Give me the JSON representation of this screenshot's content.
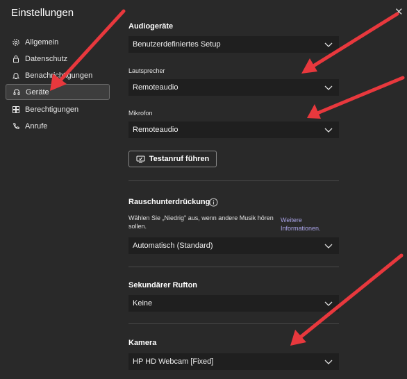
{
  "header": {
    "title": "Einstellungen",
    "close_glyph": "✕"
  },
  "sidebar": {
    "items": [
      {
        "label": "Allgemein",
        "icon": "gear-icon"
      },
      {
        "label": "Datenschutz",
        "icon": "lock-icon"
      },
      {
        "label": "Benachrichtigungen",
        "icon": "bell-icon"
      },
      {
        "label": "Geräte",
        "icon": "headset-icon",
        "active": true
      },
      {
        "label": "Berechtigungen",
        "icon": "grid-icon"
      },
      {
        "label": "Anrufe",
        "icon": "phone-icon"
      }
    ]
  },
  "audio": {
    "title": "Audiogeräte",
    "setup_value": "Benutzerdefiniertes Setup",
    "speaker_label": "Lautsprecher",
    "speaker_value": "Remoteaudio",
    "mic_label": "Mikrofon",
    "mic_value": "Remoteaudio",
    "test_button": "Testanruf führen"
  },
  "noise": {
    "title": "Rauschunterdrückung",
    "description": "Wählen Sie „Niedrig\" aus, wenn andere Musik hören sollen.",
    "link": "Weitere Informationen.",
    "value": "Automatisch (Standard)"
  },
  "ringtone": {
    "title": "Sekundärer Rufton",
    "value": "Keine"
  },
  "camera": {
    "title": "Kamera",
    "value": "HP HD Webcam [Fixed]"
  },
  "colors": {
    "background": "#292929",
    "dropdown": "#1f1f1f",
    "link": "#a8a2e6",
    "annotation_arrow": "#e8383d"
  }
}
